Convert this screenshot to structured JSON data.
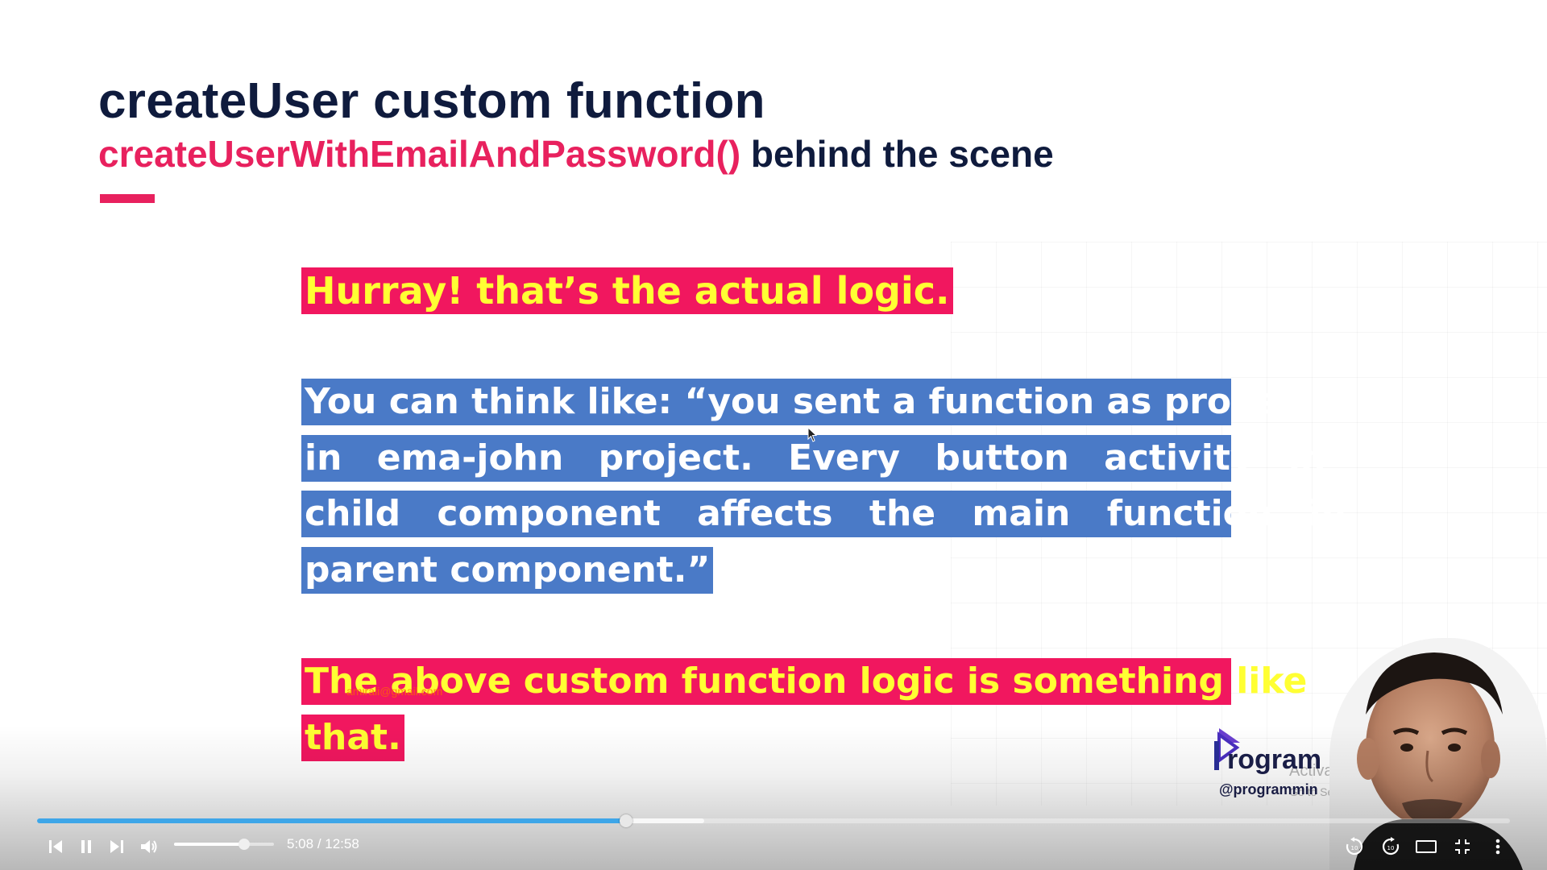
{
  "slide": {
    "title": "createUser custom function",
    "subtitle_code": "createUserWithEmailAndPassword()",
    "subtitle_rest": " behind the scene",
    "highlight_1": "Hurray! that’s the actual logic.",
    "quote_lines": [
      "You can think like: “you sent a function as props",
      "in ema-john project. Every button activity in",
      "child component affects the main function in",
      "parent component.”"
    ],
    "conclusion_lines": [
      "The above custom function logic is something like",
      "that."
    ],
    "watermark_email": "amirali@gmail.com"
  },
  "brand": {
    "name": "rogram",
    "handle": "@programmin"
  },
  "os_overlay": {
    "title": "Activate",
    "subtitle": "Go to Settings to activate Windows."
  },
  "player": {
    "current_time": "5:08",
    "separator": " / ",
    "duration": "12:58",
    "played_fraction": 0.4,
    "buffered_fraction": 0.453,
    "volume_fraction": 0.7
  },
  "icons": {
    "prev": "skip-previous-icon",
    "pause": "pause-icon",
    "next": "skip-next-icon",
    "volume": "volume-icon",
    "rewind": "rewind-10-icon",
    "forward": "forward-10-icon",
    "theater": "theater-mode-icon",
    "exit_fullscreen": "exit-fullscreen-icon",
    "more": "more-vertical-icon"
  },
  "colors": {
    "title": "#0f1b3d",
    "accent": "#e8215e",
    "highlight_pink": "#f1175f",
    "highlight_yellow_text": "#ffff33",
    "highlight_blue": "#4a7ac7",
    "progress": "#3ea6e8"
  }
}
